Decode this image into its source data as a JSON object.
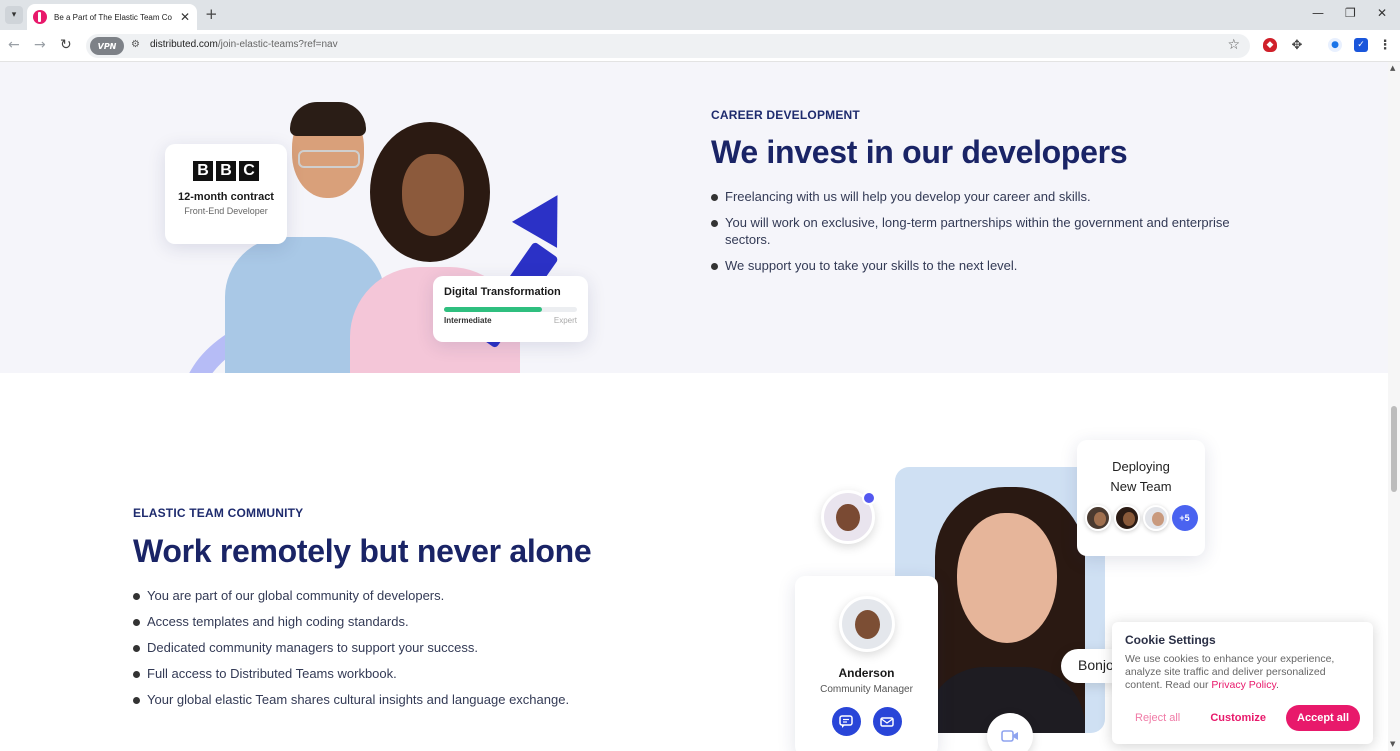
{
  "browser": {
    "tab_title": "Be a Part of The Elastic Team Co",
    "url_domain": "distributed.com",
    "url_path": "/join-elastic-teams?ref=nav",
    "vpn_label": "VPN"
  },
  "career": {
    "eyebrow": "CAREER DEVELOPMENT",
    "heading": "We invest in our developers",
    "bullets": [
      "Freelancing with us will help you develop your career and skills.",
      "You will work on exclusive, long-term partnerships within the government and enterprise sectors.",
      "We support you to take your skills to the next level."
    ],
    "bbc_card": {
      "logo_letters": [
        "B",
        "B",
        "C"
      ],
      "contract": "12-month contract",
      "role": "Front-End Developer"
    },
    "skill_card": {
      "title": "Digital Transformation",
      "level_low": "Intermediate",
      "level_high": "Expert",
      "progress_fraction": 0.74,
      "bar_color": "#2fbf7f"
    }
  },
  "community": {
    "eyebrow": "ELASTIC TEAM COMMUNITY",
    "heading": "Work remotely but never alone",
    "bullets": [
      "You are part of our global community of developers.",
      "Access templates and high coding standards.",
      "Dedicated community managers to support your success.",
      "Full access to Distributed Teams workbook.",
      "Your global elastic Team shares cultural insights and language exchange."
    ],
    "deploy_card": {
      "title_line1": "Deploying",
      "title_line2": "New Team",
      "more_count": "+5"
    },
    "anderson_card": {
      "name": "Anderson",
      "role": "Community Manager"
    },
    "chat_bubble": "Bonjour"
  },
  "cookie": {
    "title": "Cookie Settings",
    "text": "We use cookies to enhance your experience, analyze site traffic and deliver personalized content. Read our",
    "policy_link": "Privacy Policy",
    "reject_label": "Reject all",
    "customize_label": "Customize",
    "accept_label": "Accept all"
  },
  "colors": {
    "brand": "#e8196b",
    "heading": "#1a2466",
    "accent_blue": "#2945d8"
  }
}
